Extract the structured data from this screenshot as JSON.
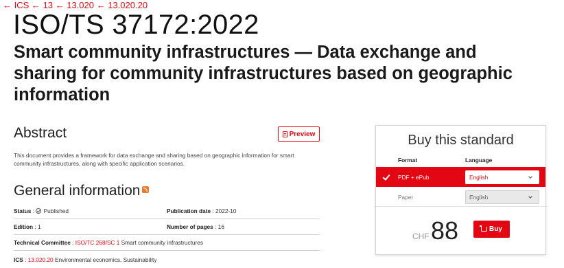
{
  "breadcrumb": {
    "items": [
      "← ICS",
      "← 13",
      "← 13.020",
      "← 13.020.20"
    ]
  },
  "standard": {
    "code": "ISO/TS 37172:2022",
    "title": "Smart community infrastructures — Data exchange and sharing for community infrastructures based on geographic information"
  },
  "abstract": {
    "heading": "Abstract",
    "preview_label": "Preview",
    "text": "This document provides a framework for data exchange and sharing based on geographic information for smart community infrastructures, along with specific application scenarios."
  },
  "general_info": {
    "heading": "General information",
    "status_label": "Status",
    "status_value": "Published",
    "publication_date_label": "Publication date",
    "publication_date_value": "2022-10",
    "edition_label": "Edition",
    "edition_value": "1",
    "pages_label": "Number of pages",
    "pages_value": "16",
    "committee_label": "Technical Committee",
    "committee_link": "ISO/TC 268/SC 1",
    "committee_name": "Smart community infrastructures",
    "ics_label": "ICS",
    "ics_link": "13.020.20",
    "ics_name": "Environmental economics. Sustainability"
  },
  "buy": {
    "title": "Buy this standard",
    "format_header": "Format",
    "language_header": "Language",
    "options": [
      {
        "format": "PDF + ePub",
        "language": "English",
        "selected": true
      },
      {
        "format": "Paper",
        "language": "English",
        "selected": false
      }
    ],
    "currency": "CHF",
    "price": "88",
    "buy_label": "Buy"
  },
  "colors": {
    "accent": "#e30613",
    "text": "#222222",
    "muted": "#777777"
  },
  "icons": [
    "arrow-left-icon",
    "rss-icon",
    "document-icon",
    "check-circle-icon",
    "check-icon",
    "chevron-down-icon",
    "cart-icon"
  ]
}
